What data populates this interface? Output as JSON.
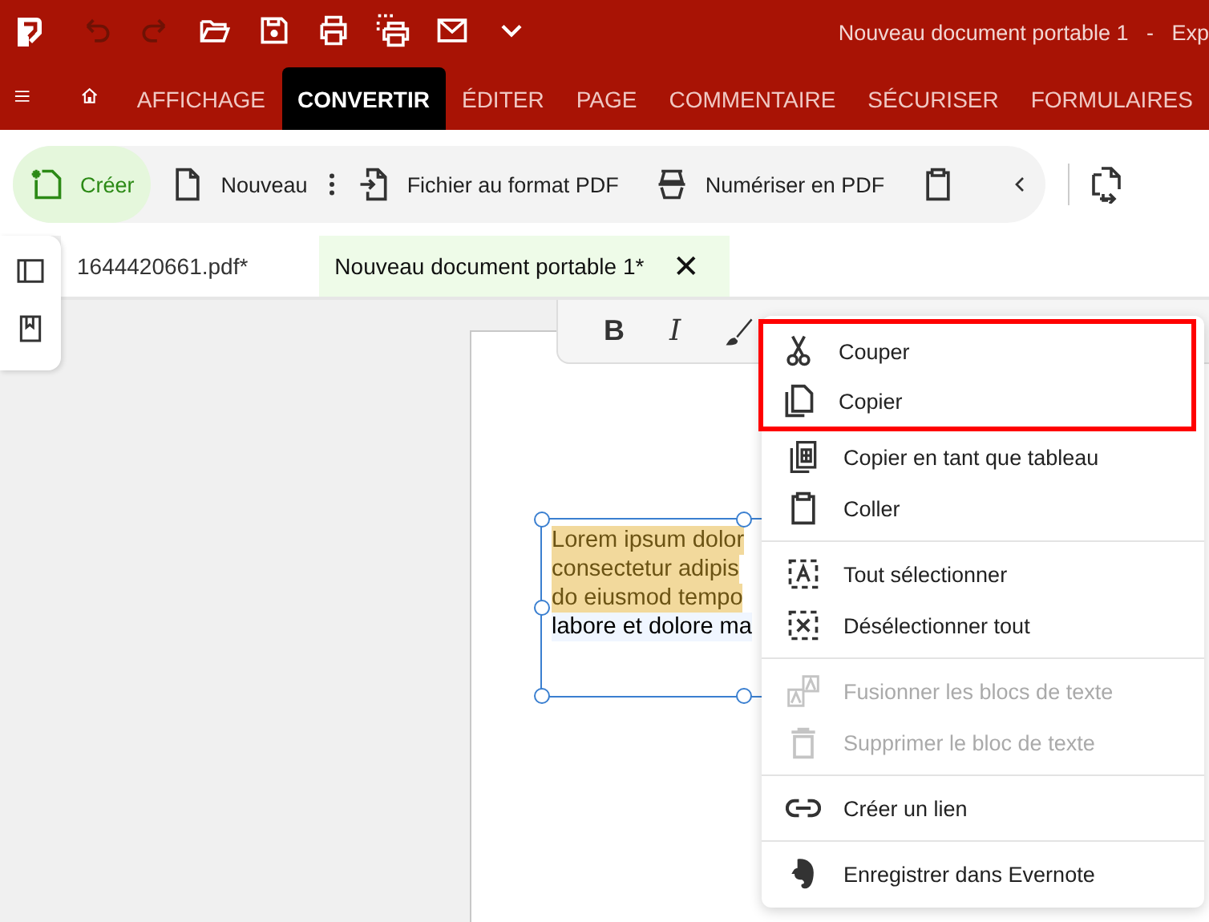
{
  "window": {
    "title": "Nouveau document portable 1   -   Exp"
  },
  "toolbar": {
    "buttons": [
      {
        "kind": "undo",
        "disabled": true
      },
      {
        "kind": "redo",
        "disabled": true
      },
      {
        "kind": "open",
        "disabled": false
      },
      {
        "kind": "save",
        "disabled": false
      },
      {
        "kind": "print",
        "disabled": false
      },
      {
        "kind": "print-area",
        "disabled": false
      },
      {
        "kind": "mail",
        "disabled": false
      },
      {
        "kind": "more",
        "disabled": false
      }
    ]
  },
  "tabs": [
    {
      "label": "AFFICHAGE",
      "selected": false
    },
    {
      "label": "CONVERTIR",
      "selected": true
    },
    {
      "label": "ÉDITER",
      "selected": false
    },
    {
      "label": "PAGE",
      "selected": false
    },
    {
      "label": "COMMENTAIRE",
      "selected": false
    },
    {
      "label": "SÉCURISER",
      "selected": false
    },
    {
      "label": "FORMULAIRES",
      "selected": false
    }
  ],
  "ribbon": {
    "items": [
      {
        "kind": "create",
        "label": "Créer",
        "selected": true
      },
      {
        "kind": "new",
        "label": "Nouveau",
        "selected": false
      },
      {
        "kind": "file",
        "label": "Fichier au format PDF",
        "selected": false
      },
      {
        "kind": "scan",
        "label": "Numériser en PDF",
        "selected": false
      },
      {
        "kind": "clipboard",
        "selected": false
      }
    ]
  },
  "documents": [
    {
      "label": "1644420661.pdf*",
      "selected": false
    },
    {
      "label": "Nouveau document portable 1*",
      "selected": true,
      "close": "✕"
    }
  ],
  "format_toolbar": {
    "bold": "B",
    "italic": "I"
  },
  "text_box": {
    "lines": [
      {
        "text": "Lorem ipsum dolor",
        "selected": true
      },
      {
        "text": "consectetur adipis",
        "selected": true
      },
      {
        "text": "do eiusmod tempo",
        "selected": true
      },
      {
        "text": "labore et dolore ma",
        "selected": false
      }
    ]
  },
  "context_menu": {
    "groups": [
      {
        "items": [
          {
            "label": "Couper",
            "disabled": false,
            "highlighted": true
          },
          {
            "label": "Copier",
            "disabled": false,
            "highlighted": true
          },
          {
            "label": "Copier en tant que tableau",
            "disabled": false,
            "highlighted": false
          },
          {
            "label": "Coller",
            "disabled": false,
            "highlighted": false
          }
        ]
      },
      {
        "items": [
          {
            "label": "Tout sélectionner",
            "disabled": false,
            "highlighted": false
          },
          {
            "label": "Désélectionner tout",
            "disabled": false,
            "highlighted": false
          }
        ]
      },
      {
        "items": [
          {
            "label": "Fusionner les blocs de texte",
            "disabled": true,
            "highlighted": false
          },
          {
            "label": "Supprimer le bloc de texte",
            "disabled": true,
            "highlighted": false
          }
        ]
      },
      {
        "items": [
          {
            "label": "Créer un lien",
            "disabled": false,
            "highlighted": false
          }
        ]
      },
      {
        "items": [
          {
            "label": "Enregistrer dans Evernote",
            "disabled": false,
            "highlighted": false
          }
        ]
      }
    ]
  }
}
